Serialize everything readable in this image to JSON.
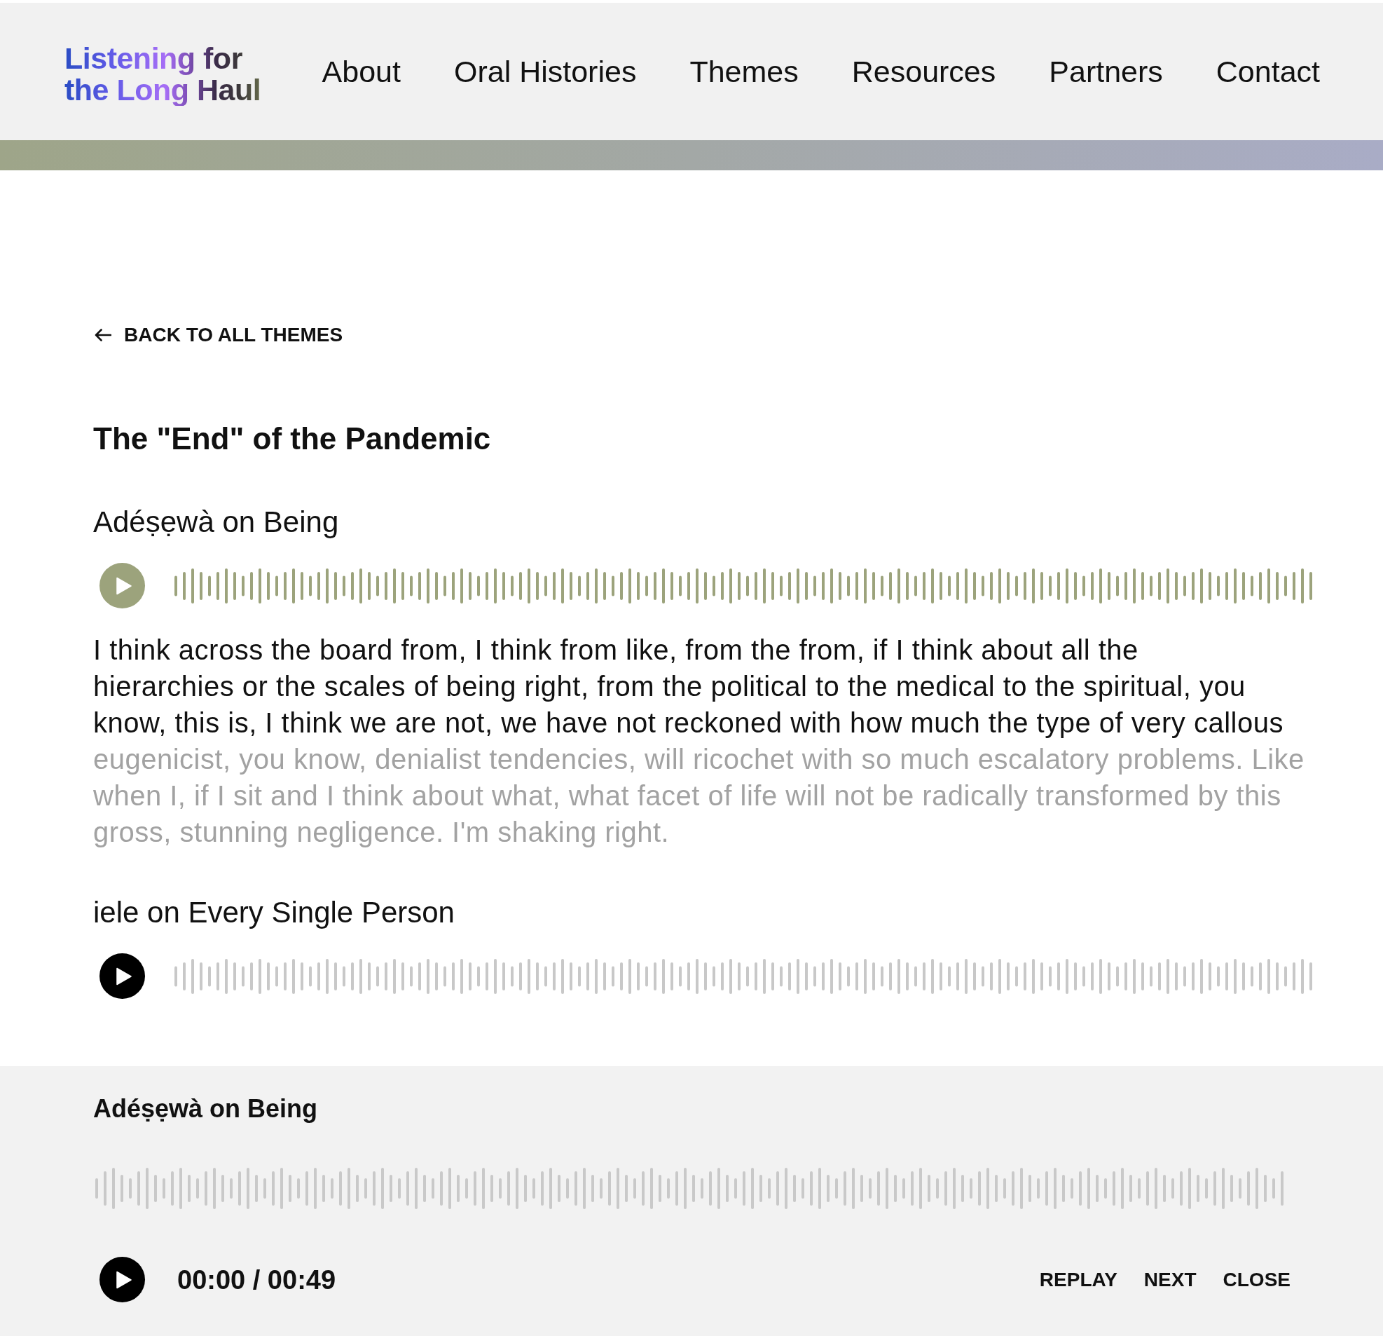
{
  "header": {
    "logo": "Listening for the Long Haul",
    "nav": [
      "About",
      "Oral Histories",
      "Themes",
      "Resources",
      "Partners",
      "Contact"
    ]
  },
  "back_link": "BACK TO ALL THEMES",
  "title": "The \"End\" of the Pandemic",
  "clips": [
    {
      "title": "Adéṣẹwà on Being",
      "selected": true,
      "transcript": [
        {
          "text": "I think across the board from, I think from like, from the from, if I think about all the",
          "spoken": true
        },
        {
          "text": "hierarchies or the scales of being right, from the political to the medical to the spiritual, you",
          "spoken": true
        },
        {
          "text": "know, this is, I think we are not, we have not reckoned with how much the type of very callous",
          "spoken": true
        },
        {
          "text": "eugenicist, you know, denialist tendencies, will ricochet with so much escalatory problems. Like",
          "spoken": false
        },
        {
          "text": "when I, if I sit and I think about what, what facet of life will not be radically transformed by this",
          "spoken": false
        },
        {
          "text": "gross, stunning negligence. I'm shaking right.",
          "spoken": false
        }
      ]
    },
    {
      "title": "iele on Every Single Person",
      "selected": false
    }
  ],
  "player": {
    "title": "Adéṣẹwà on Being",
    "time": "00:00 / 00:49",
    "actions": [
      "REPLAY",
      "NEXT",
      "CLOSE"
    ]
  }
}
